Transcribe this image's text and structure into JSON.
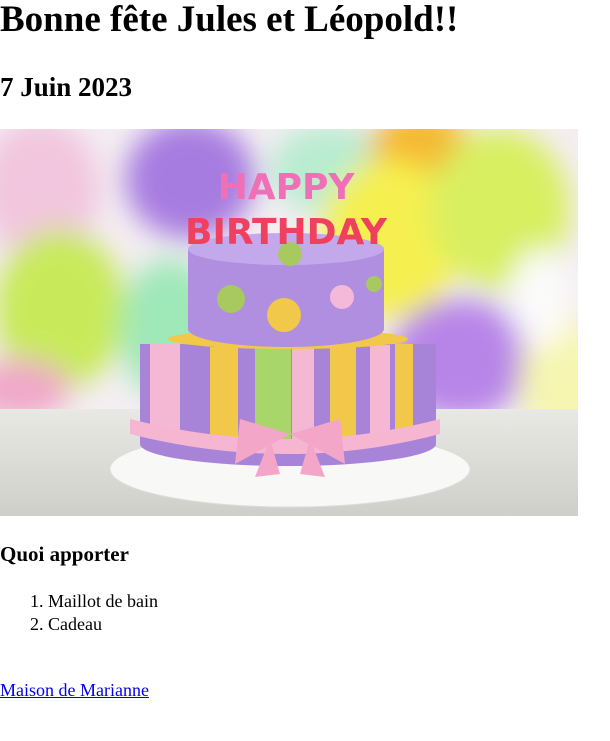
{
  "page": {
    "title": "Bonne fête Jules et Léopold!!",
    "date": "7 Juin 2023"
  },
  "cake_image": {
    "description_icon": "birthday-cake-image",
    "lettering_top": "HAPPY",
    "lettering_bottom": "BIRTHDAY"
  },
  "bring": {
    "heading": "Quoi apporter",
    "items": [
      "Maillot de bain",
      "Cadeau"
    ]
  },
  "link": {
    "label": "Maison de Marianne"
  }
}
